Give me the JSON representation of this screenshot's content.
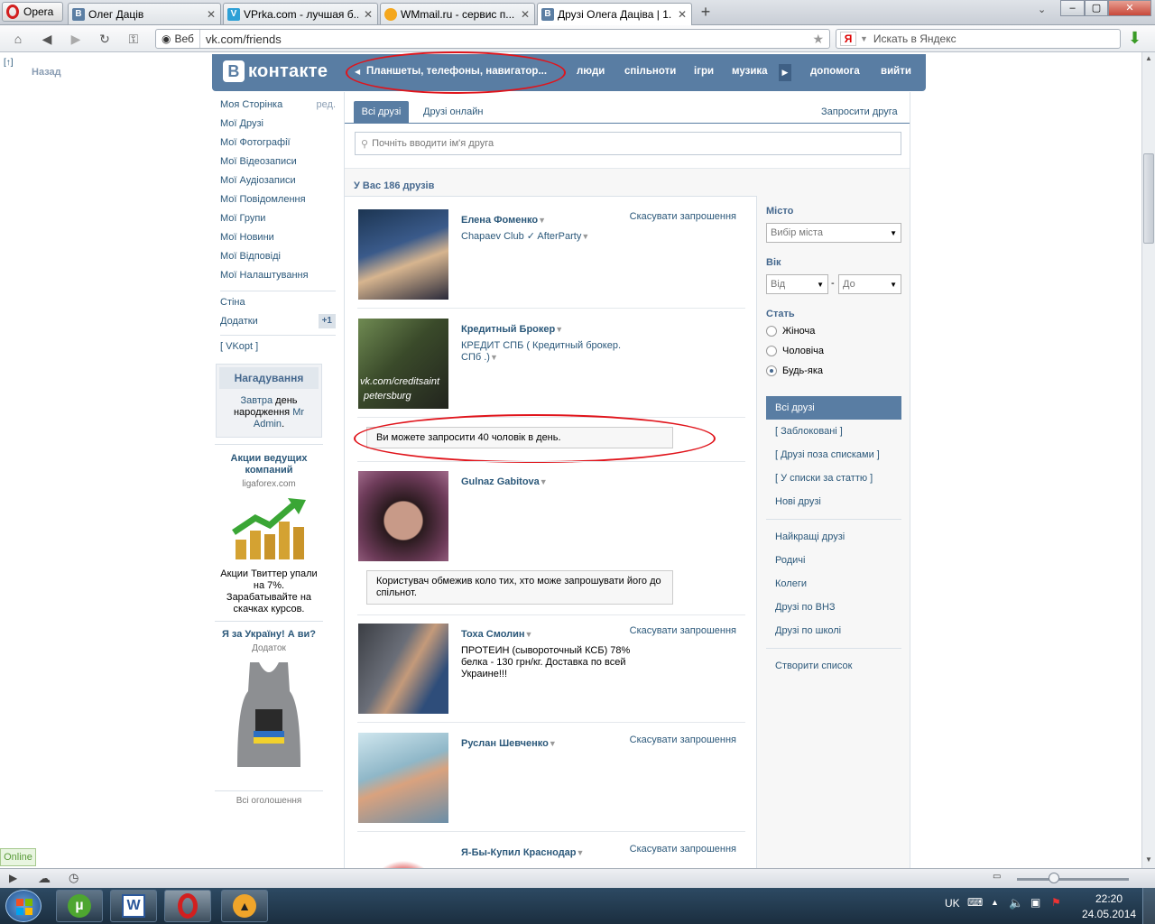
{
  "browser": {
    "opera_label": "Opera",
    "tabs": [
      {
        "label": "Олег Дацiв",
        "icon": "vk-icon"
      },
      {
        "label": "VPrka.com - лучшая б...",
        "icon": "vprka-icon"
      },
      {
        "label": "WMmail.ru - сервис п...",
        "icon": "wmmail-icon"
      },
      {
        "label": "Друзi Олега Дацiва | 1...",
        "icon": "vk-icon",
        "active": true
      }
    ],
    "addr_label": "Веб",
    "url": "vk.com/friends",
    "search_placeholder": "Искать в Яндекс",
    "search_engine_letter": "Я"
  },
  "vk": {
    "logo_b": "В",
    "logo_text": "контакте",
    "ad_text": "Планшеты, телефоны, навигатор...",
    "nav": [
      "люди",
      "спільноти",
      "ігри",
      "музика",
      "допомога",
      "вийти"
    ],
    "back_label": "Назад",
    "back_glyph": "[↑]"
  },
  "sidebar": {
    "items": [
      "Моя Сторінка",
      "Мої Друзі",
      "Мої Фотографії",
      "Мої Відеозаписи",
      "Мої Аудіозаписи",
      "Мої Повідомлення",
      "Мої Групи",
      "Мої Новини",
      "Мої Відповіді",
      "Мої Налаштування"
    ],
    "edit_label": "ред.",
    "wall": "Стіна",
    "apps": "Додатки",
    "apps_badge": "+1",
    "vkopt": "[ VKopt ]",
    "reminder_title": "Нагадування",
    "reminder_a": "Завтра",
    "reminder_b": " день народження ",
    "reminder_c": "Mr Admin",
    "reminder_d": ".",
    "ad1_title": "Акции ведущих компаний",
    "ad1_domain": "ligaforex.com",
    "ad1_text": "Акции Твиттер упали на 7%. Зарабатывайте на скачках курсов.",
    "ad2_title": "Я за Україну! А ви?",
    "ad2_sub": "Додаток",
    "all_ads": "Всі оголошення"
  },
  "friends": {
    "tabs": [
      "Всі друзі",
      "Друзі онлайн"
    ],
    "invite": "Запросити друга",
    "search_placeholder": "Почніть вводити ім'я друга",
    "count": "У Вас 186 друзів",
    "list": [
      {
        "name": "Елена Фоменко",
        "sub": "Chapaev Club ✓ AfterParty",
        "action": "Скасувати запрошення"
      },
      {
        "name": "Кредитный Брокер",
        "sub": "КРЕДИТ СПБ ( Кредитный брокер. СПб .)",
        "action": "",
        "photo_text_a": "vk.com/creditsaint",
        "photo_text_b": "petersburg"
      },
      {
        "name": "Gulnaz Gabitova",
        "sub": "",
        "action": ""
      },
      {
        "name": "Тоха Смолин",
        "sub": "ПРОТЕИН (сывороточный КСБ) 78% белка - 130 грн/кг. Доставка по всей Украине!!!",
        "action": "Скасувати запрошення"
      },
      {
        "name": "Руслан Шевченко",
        "sub": "",
        "action": "Скасувати запрошення"
      },
      {
        "name": "Я-Бы-Купил Краснодар",
        "sub": "",
        "action": "Скасувати запрошення"
      }
    ],
    "notice_limit": "Ви можете запросити 40 чоловік в день.",
    "notice_restricted": "Користувач обмежив коло тих, хто може запрошувати його до спільнот."
  },
  "filters": {
    "city_title": "Місто",
    "city_value": "Вибір міста",
    "age_title": "Вік",
    "age_from": "Від",
    "age_to": "До",
    "age_dash": "-",
    "gender_title": "Стать",
    "genders": [
      "Жіноча",
      "Чоловіча",
      "Будь-яка"
    ],
    "gender_selected": 2,
    "lists": [
      "Всі друзі",
      "[ Заблоковані ]",
      "[ Друзі поза списками ]",
      "[ У списки за статтю ]",
      "Нові друзі"
    ],
    "lists2": [
      "Найкращі друзі",
      "Родичі",
      "Колеги",
      "Друзі по ВНЗ",
      "Друзі по школі"
    ],
    "create": "Створити список"
  },
  "status": {
    "online": "Online"
  },
  "taskbar": {
    "lang": "UK",
    "time": "22:20",
    "date": "24.05.2014"
  },
  "colors": {
    "vk_blue": "#597da3",
    "link": "#2b587a",
    "annotation_red": "#e0141b"
  }
}
